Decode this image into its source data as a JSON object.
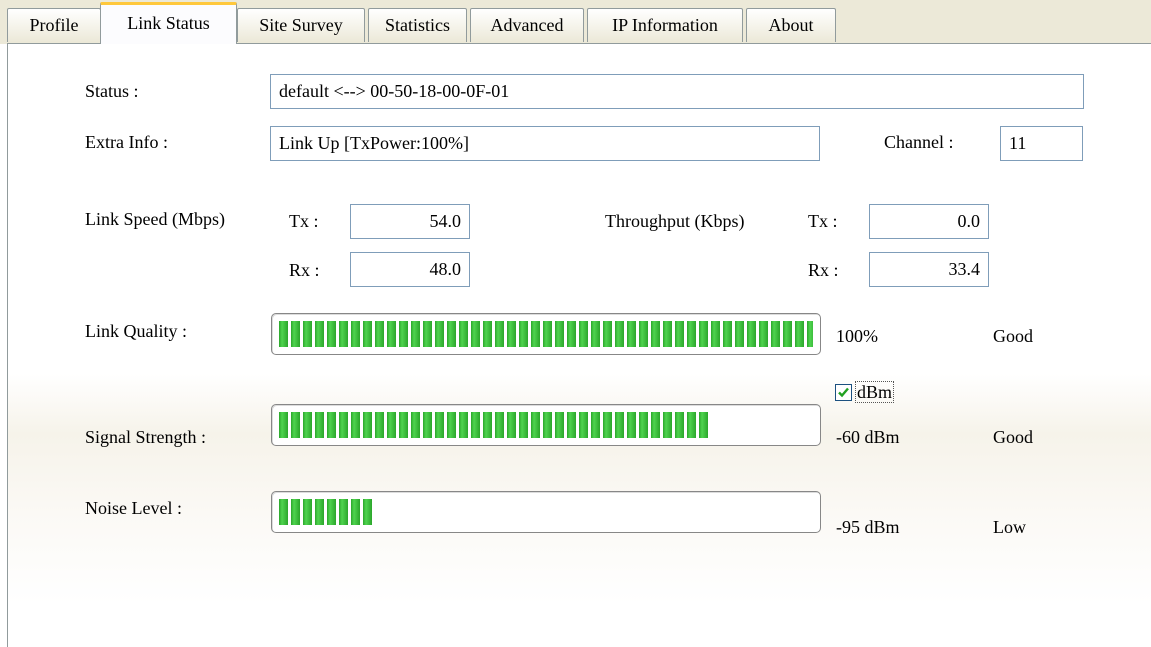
{
  "tabs": [
    {
      "label": "Profile",
      "active": false
    },
    {
      "label": "Link Status",
      "active": true
    },
    {
      "label": "Site Survey",
      "active": false
    },
    {
      "label": "Statistics",
      "active": false
    },
    {
      "label": "Advanced",
      "active": false
    },
    {
      "label": "IP Information",
      "active": false
    },
    {
      "label": "About",
      "active": false
    }
  ],
  "status": {
    "label": "Status :",
    "value": "default <--> 00-50-18-00-0F-01"
  },
  "extra_info": {
    "label": "Extra Info :",
    "value": "Link Up [TxPower:100%]"
  },
  "channel": {
    "label": "Channel :",
    "value": "11"
  },
  "link_speed": {
    "label": "Link Speed (Mbps)",
    "tx_label": "Tx :",
    "tx": "54.0",
    "rx_label": "Rx :",
    "rx": "48.0"
  },
  "throughput": {
    "label": "Throughput (Kbps)",
    "tx_label": "Tx :",
    "tx": "0.0",
    "rx_label": "Rx :",
    "rx": "33.4"
  },
  "link_quality": {
    "label": "Link Quality :",
    "value": "100%",
    "rating": "Good",
    "level": 1.0
  },
  "dbm_toggle": {
    "label": "dBm",
    "checked": true
  },
  "signal_strength": {
    "label": "Signal Strength :",
    "value": "-60 dBm",
    "rating": "Good",
    "level": 0.8
  },
  "noise_level": {
    "label": "Noise Level :",
    "value": "-95 dBm",
    "rating": "Low",
    "level": 0.176
  },
  "colors": {
    "bar_fill": "#2ba62b",
    "active_tab_highlight": "#ffc83c"
  }
}
